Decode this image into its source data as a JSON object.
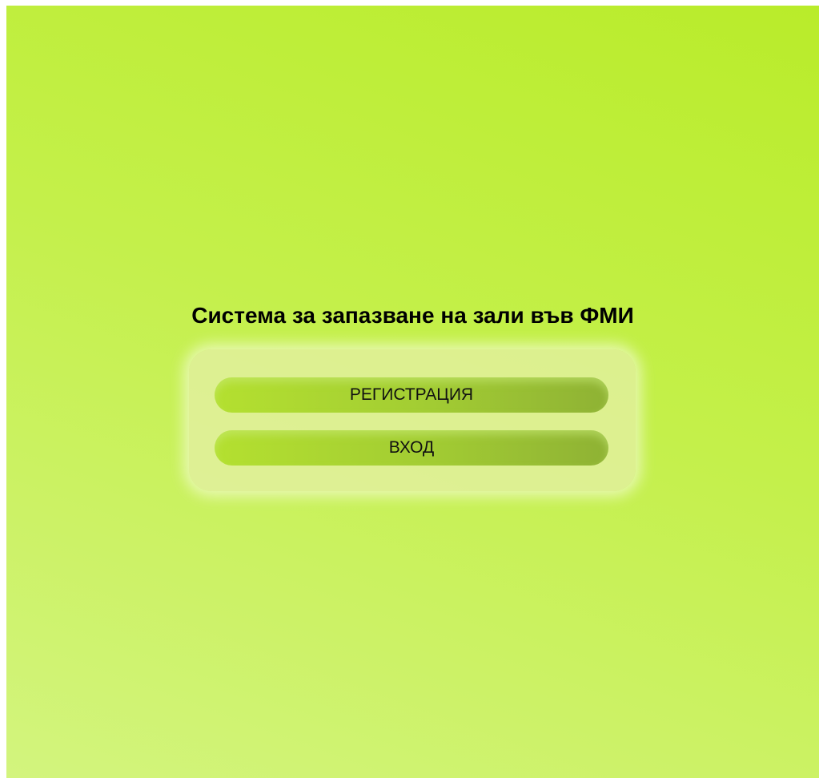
{
  "page": {
    "title": "Система за запазване на зали във ФМИ"
  },
  "actions": {
    "register_label": "РЕГИСТРАЦИЯ",
    "login_label": "ВХОД"
  },
  "colors": {
    "background_start": "#b9ec2a",
    "background_end": "#d3f47e",
    "button": "#a2cc33",
    "text": "#000000"
  }
}
